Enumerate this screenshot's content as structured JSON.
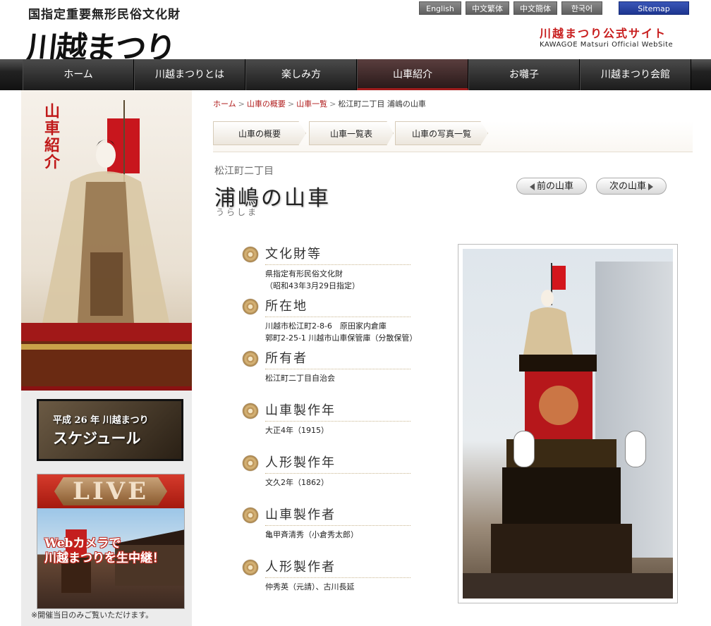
{
  "header": {
    "top_caption": "国指定重要無形民俗文化財",
    "logo_text": "川越まつり",
    "lang_buttons": [
      "English",
      "中文繁体語",
      "中文簡体語",
      "한국어"
    ],
    "sitemap": "Sitemap",
    "site_title_jp": "川越まつり公式サイト",
    "site_title_en": "KAWAGOE Matsuri Official WebSite"
  },
  "nav": {
    "items": [
      "ホーム",
      "川越まつりとは",
      "楽しみ方",
      "山車紹介",
      "お囃子",
      "川越まつり会館"
    ],
    "active_index": 3
  },
  "sidebar": {
    "hero_label": "山車紹介",
    "schedule_line1": "平成 26 年 川越まつり",
    "schedule_line2": "スケジュール",
    "live_title": "LIVE",
    "live_caption_line1": "Webカメラで",
    "live_caption_line2": "川越まつりを生中継！",
    "live_note": "※開催当日のみご覧いただけます。"
  },
  "breadcrumb": {
    "items": [
      "ホーム",
      "山車の概要",
      "山車一覧"
    ],
    "current": "松江町二丁目 浦嶋の山車"
  },
  "subtabs": [
    "山車の概要",
    "山車一覧表",
    "山車の写真一覧"
  ],
  "page": {
    "area": "松江町二丁目",
    "title": "浦嶋の山車",
    "reading": "うらしま",
    "prev": "前の山車",
    "next": "次の山車"
  },
  "info": [
    {
      "head": "文化財等",
      "body": "県指定有形民俗文化財\n（昭和43年3月29日指定）"
    },
    {
      "head": "所在地",
      "body": "川越市松江町2-8-6　原田家内倉庫\n郭町2-25-1 川越市山車保管庫（分散保管）"
    },
    {
      "head": "所有者",
      "body": "松江町二丁目自治会"
    },
    {
      "head": "山車製作年",
      "body": "大正4年（1915）"
    },
    {
      "head": "人形製作年",
      "body": "文久2年（1862）"
    },
    {
      "head": "山車製作者",
      "body": "亀甲斉清秀（小倉秀太郎）"
    },
    {
      "head": "人形製作者",
      "body": "仲秀英（元請）、古川長延"
    }
  ]
}
